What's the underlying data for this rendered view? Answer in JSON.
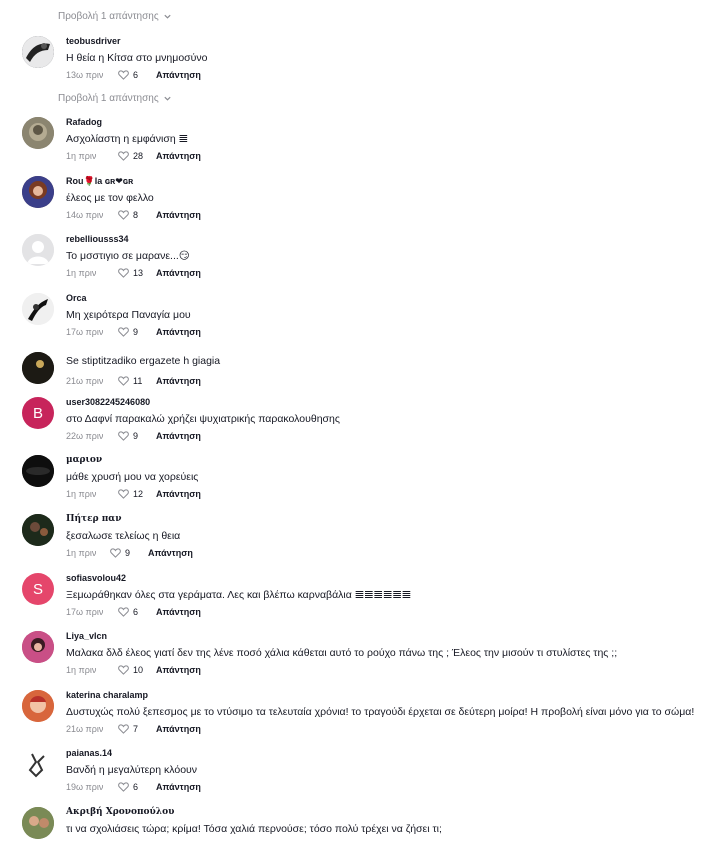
{
  "view_replies_label": "Προβολή 1 απάντησης",
  "reply_label": "Απάντηση",
  "comments": [
    {
      "user": "teobusdriver",
      "text": "Η θεία η Κίτσα στο μνημοσύνο",
      "time": "13ω πριν",
      "likes": "6"
    },
    {
      "user": "Rafadog",
      "text": "Ασχολίαστη η εμφάνιση 𝌆",
      "time": "1η πριν",
      "likes": "28"
    },
    {
      "user": "Rou🌹la ɢʀ❤ɢʀ",
      "text": "έλεος με τον φελλο",
      "time": "14ω πριν",
      "likes": "8"
    },
    {
      "user": "rebelliousss34",
      "text": "Το μσστιγιο σε μαρανε...😏",
      "time": "1η πριν",
      "likes": "13"
    },
    {
      "user": "Orca",
      "text": "Μη χειρότερα Παναγία μου",
      "time": "17ω πριν",
      "likes": "9"
    },
    {
      "user": "",
      "text": "Se stiptitzadiko ergazete h giagia",
      "time": "21ω πριν",
      "likes": "11"
    },
    {
      "user": "user3082245246080",
      "text": "στο Δαφνί παρακαλώ χρήζει ψυχιατρικής παρακολουθησης",
      "time": "22ω πριν",
      "likes": "9",
      "avatar_letter": "B"
    },
    {
      "user": "μαριον",
      "text": "μάθε χρυσή μου να χορεύεις",
      "time": "1η πριν",
      "likes": "12"
    },
    {
      "user": "Πήτερ παν",
      "text": "ξεσαλωσε τελείως η θεια",
      "time": "1η πριν",
      "likes": "9"
    },
    {
      "user": "sofiasvolou42",
      "text": "Ξεμωράθηκαν όλες στα γεράματα. Λες και βλέπω καρναβάλια 𝌆𝌆𝌆𝌆𝌆𝌆",
      "time": "17ω πριν",
      "likes": "6",
      "avatar_letter": "S"
    },
    {
      "user": "Liya_vlcn",
      "text": "Μαλακα δλδ έλεος γιατί δεν της λένε ποσό χάλια κάθεται αυτό το ρούχο πάνω της ; Έλεος την μισούν τι στυλίστες της ;;",
      "time": "1η πριν",
      "likes": "10"
    },
    {
      "user": "katerina charalamp",
      "text": "Δυστυχώς πολύ ξεπεσμος με το ντύσιμο τα τελευταία χρόνια! το τραγούδι έρχεται σε δεύτερη μοίρα! Η προβολή είναι μόνο για το σώμα!",
      "time": "21ω πριν",
      "likes": "7"
    },
    {
      "user": "paianas.14",
      "text": "Βανδή η μεγαλύτερη κλόουν",
      "time": "19ω πριν",
      "likes": "6"
    },
    {
      "user": "Ακριβή Χρονοπούλου",
      "text": "τι να σχολιάσεις τώρα; κρίμα! Τόσα χαλιά περνούσε; τόσο πολύ τρέχει να ζήσει τι;",
      "time": "",
      "likes": ""
    }
  ],
  "colors": {
    "link_gray": "#8a8b91",
    "text": "#161823",
    "avatar_b": "#c7245b",
    "avatar_s": "#e5466b"
  }
}
